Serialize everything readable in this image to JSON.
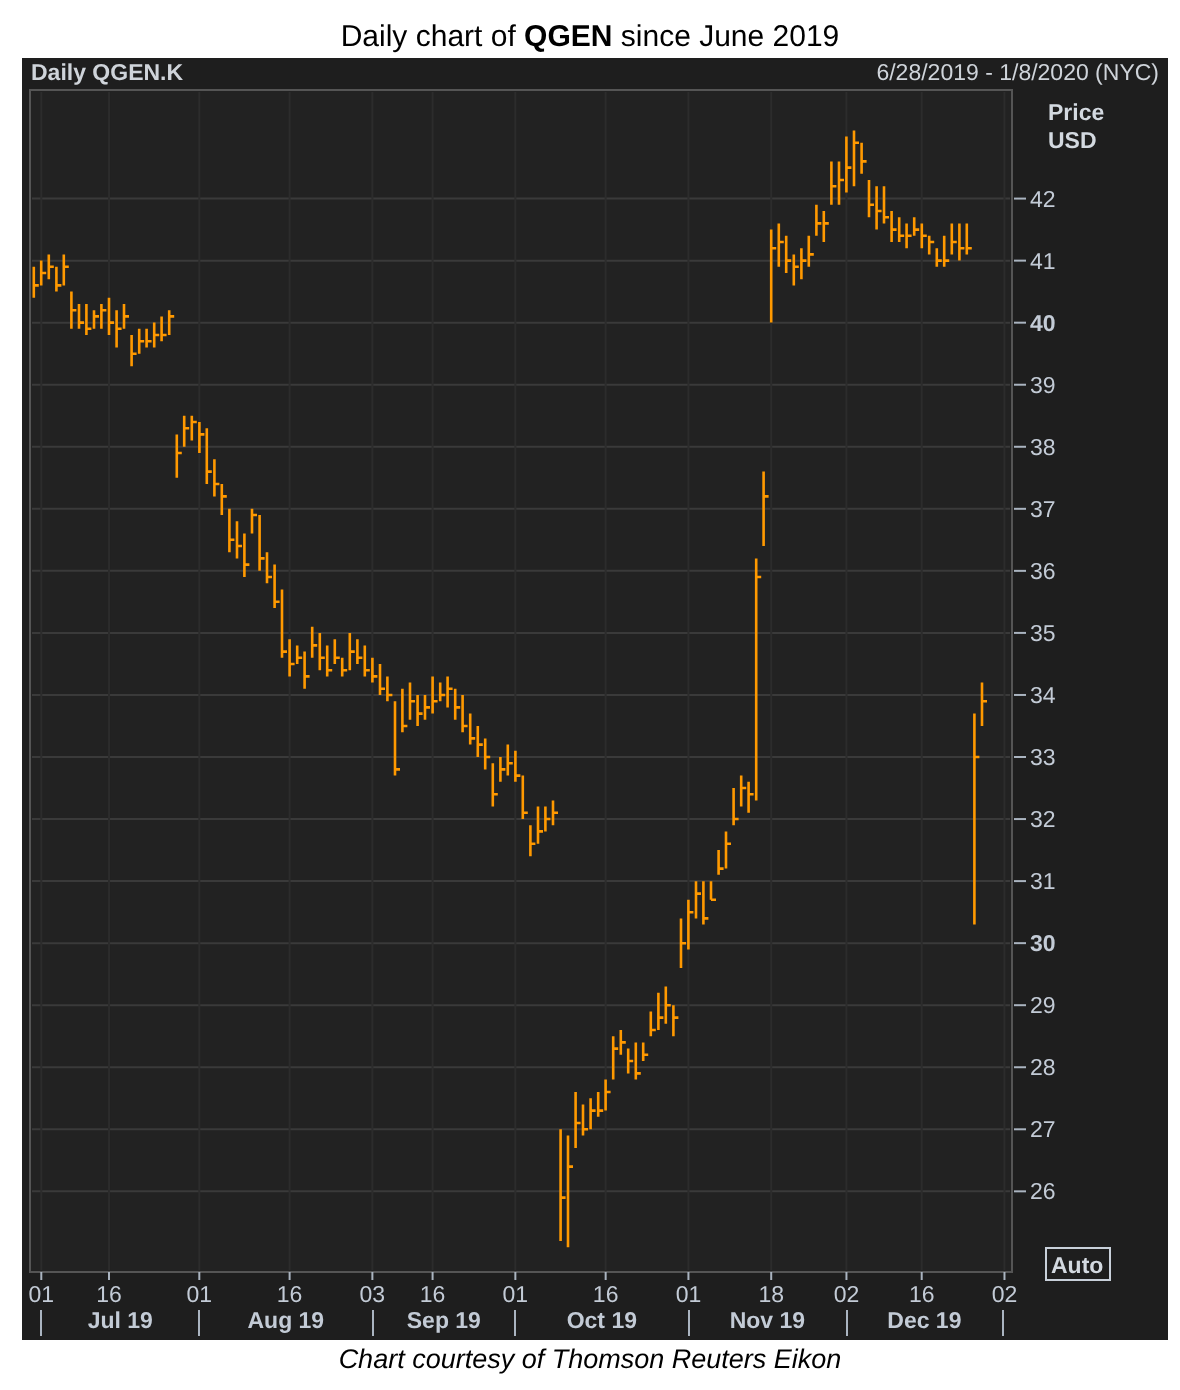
{
  "title": "Daily chart of **QGEN** since June 2019",
  "chart_header": {
    "instrument": "Daily QGEN.K",
    "date_range": "6/28/2019 - 1/8/2020 (NYC)"
  },
  "y_axis_title": [
    "Price",
    "USD"
  ],
  "y_ticks": [
    "42",
    "41",
    "40",
    "39",
    "38",
    "37",
    "36",
    "35",
    "34",
    "33",
    "32",
    "31",
    "30",
    "29",
    "28",
    "27",
    "26"
  ],
  "x_ticks": [
    "01",
    "16",
    "01",
    "16",
    "03",
    "16",
    "01",
    "16",
    "01",
    "18",
    "02",
    "16",
    "02"
  ],
  "months": [
    "Jul 19",
    "Aug 19",
    "Sep 19",
    "Oct 19",
    "Nov 19",
    "Dec 19"
  ],
  "scale_button": "Auto",
  "caption": "Chart courtesy of Thomson Reuters Eikon"
}
